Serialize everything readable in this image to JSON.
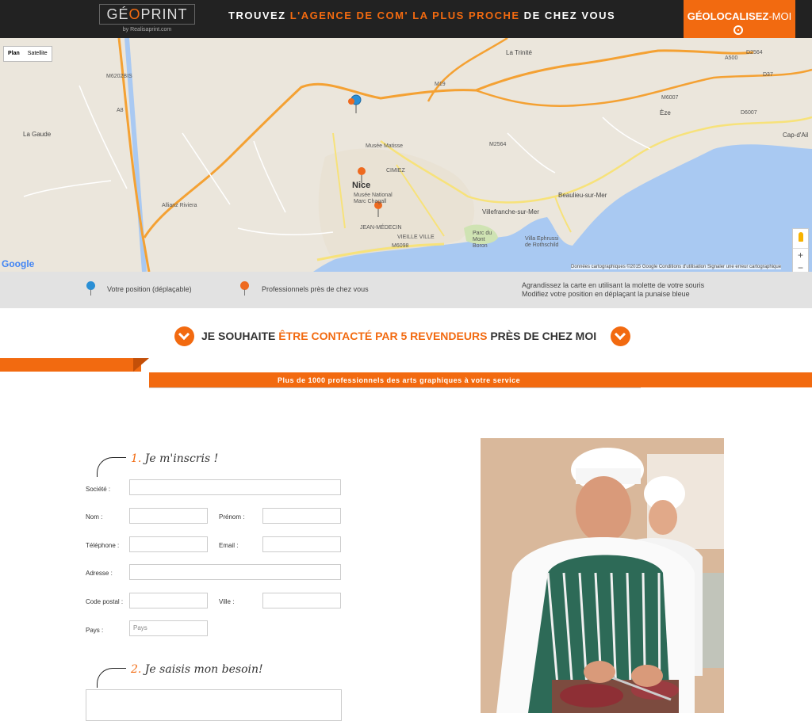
{
  "header": {
    "logo_pre": "GÉ",
    "logo_o": "O",
    "logo_post": "PRINT",
    "logo_sub": "by Realisaprint.com",
    "tagline_1": "TROUVEZ ",
    "tagline_hl": "L'AGENCE DE COM' LA PLUS PROCHE",
    "tagline_2": " DE CHEZ VOUS",
    "geo_bold": "GÉOLOCALISEZ",
    "geo_rest": "-MOI",
    "geo_icon": "target-icon"
  },
  "map": {
    "type_plan": "Plan",
    "type_satellite": "Satellite",
    "zoom_in": "+",
    "zoom_out": "−",
    "google": "Google",
    "footer": "Données cartographiques ©2015 Google    Conditions d'utilisation    Signaler une erreur cartographique",
    "labels": {
      "nice": "Nice",
      "la_gaude": "La Gaude",
      "la_trinite": "La Trinité",
      "eze": "Èze",
      "cap_dail": "Cap-d'Ail",
      "beaulieu": "Beaulieu-sur-Mer",
      "villefranche": "Villefranche-sur-Mer",
      "musee_matisse": "Musée Matisse",
      "musee_chagall": "Musée National Marc Chagall",
      "cimiez": "CIMIEZ",
      "jean_medecin": "JEAN-MÉDECIN",
      "vieille_ville": "VIEILLE VILLE",
      "allianz": "Allianz Riviera",
      "mont_boron": "Parc du Mont Boron",
      "ephrussi": "Villa Ephrussi de Rothschild",
      "a8": "A8",
      "m19": "M19",
      "m6202bis": "M6202BIS",
      "m2564": "M2564",
      "m6098": "M6098",
      "m6007": "M6007",
      "d6007": "D6007",
      "a500": "A500",
      "d2564": "D2564",
      "d37": "D37"
    }
  },
  "legend": {
    "position": "Votre position (déplaçable)",
    "pros": "Professionnels près de chez vous",
    "hint_1": "Agrandissez la carte en utilisant la molette de votre souris",
    "hint_2": "Modifiez votre position en déplaçant la punaise bleue"
  },
  "contact": {
    "pre": "JE SOUHAITE ",
    "hl": "ÊTRE CONTACTÉ PAR 5 REVENDEURS",
    "post": " PRÈS DE CHEZ MOI"
  },
  "ribbon_text": "Plus de 1000 professionnels des arts graphiques à votre service",
  "form": {
    "step1_num": "1.",
    "step1_text": " Je m'inscris !",
    "step2_num": "2.",
    "step2_text": " Je saisis mon besoin!",
    "labels": {
      "societe": "Société :",
      "nom": "Nom :",
      "prenom": "Prénom :",
      "telephone": "Téléphone :",
      "email": "Email :",
      "adresse": "Adresse :",
      "code_postal": "Code postal :",
      "ville": "Ville :",
      "pays": "Pays :"
    },
    "pays_placeholder": "Pays"
  },
  "colors": {
    "accent": "#f26a10",
    "header_bg": "#222222",
    "map_bg": "#ebe6dc",
    "sea": "#a9c9f2",
    "legend_bg": "#e2e2e2"
  }
}
